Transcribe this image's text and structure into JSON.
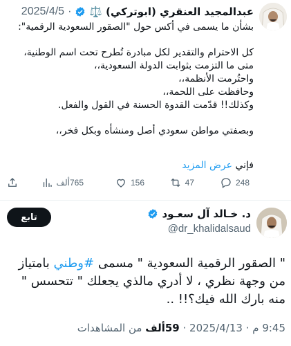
{
  "tweet_a": {
    "author_name": "عبدالمجيد العنقري (ابوتركي)",
    "date": "2025/4/5",
    "separator": "·",
    "badge_emoji": "⚖️",
    "lines": [
      "بشأن ما يسمى في أكس حول \"الصقور السعودية الرقمية\":",
      "",
      "كل الاحترام والتقدير لكل مبادرة تُطرح تحت اسم الوطنية،",
      "متى ما التزمت بثوابت الدولة السعودية،،",
      "واحتُرمت الأنظمة،،",
      "وحافظت على اللحمة،،",
      "وكذلك!! قدّمت القدوة الحسنة في القول والفعل.",
      "",
      "وبصفتي مواطن سعودي أصل ومنشأه وبكل فخر،،"
    ],
    "more_prefix": "فإني",
    "more_link": "عرض المزيد",
    "actions": {
      "replies": "248",
      "reposts": "47",
      "likes": "156",
      "views": "765ألف"
    }
  },
  "tweet_b": {
    "author_name": "د. خـالد آل سعـود",
    "handle": "@dr_khalidalsaud",
    "follow_label": "تابع",
    "text_part1": "\" الصقور الرقمية السعودية \" مسمى ",
    "hashtag": "#وطني",
    "text_part2": " بامتياز من وجهة نظري ، لا أدري مالذي يجعلك \" تتحسس \" منه بارك الله فيك؟!! ..",
    "meta_prefix": "9:45 م · 2025/4/13 · ",
    "views_count": "59ألف",
    "views_label": " من المشاهدات"
  },
  "colors": {
    "accent": "#1d9bf0",
    "text": "#0f1419",
    "muted": "#536471",
    "divider": "#eff3f4"
  },
  "icons": [
    "reply-icon",
    "repost-icon",
    "like-icon",
    "views-icon",
    "share-icon",
    "verified-badge-icon",
    "scales-icon"
  ]
}
